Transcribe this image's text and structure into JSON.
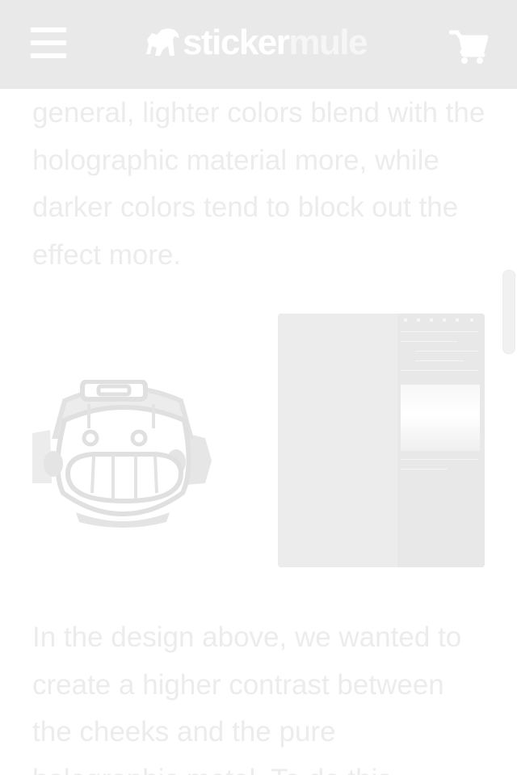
{
  "header": {
    "menu_icon": "hamburger-menu-icon",
    "logo": {
      "part1": "sticker",
      "part2": "mule",
      "icon": "mule-logo-icon"
    },
    "cart_icon": "shopping-cart-icon",
    "background_color": "#e9e9e9"
  },
  "article": {
    "paragraph_1": "general, lighter colors blend with the holographic material more, while darker colors tend to block out the effect more.",
    "paragraph_2": "In the design above, we wanted to create a higher contrast between the cheeks and the pure holographic metal. To do this"
  },
  "images": {
    "illustration": "robot-face-sticker-illustration",
    "screenshot": "design-app-screenshot"
  },
  "colors": {
    "text": "#ececec",
    "header": "#e9e9e9",
    "logo": "#ffffff"
  }
}
